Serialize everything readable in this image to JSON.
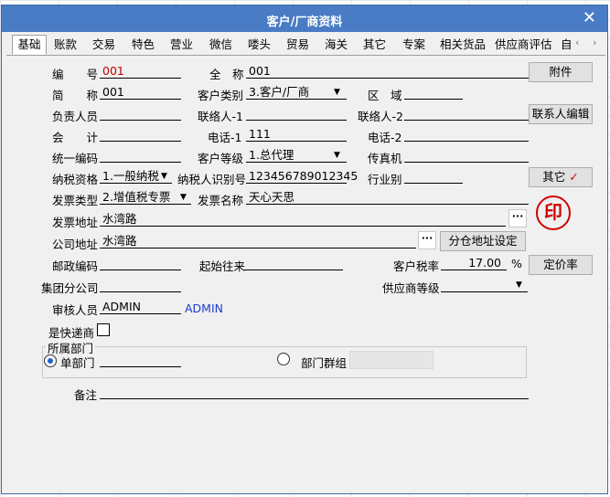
{
  "window": {
    "title": "客户/厂商资料"
  },
  "tabs": [
    "基础",
    "账款",
    "交易",
    "特色",
    "营业",
    "微信",
    "喽头",
    "贸易",
    "海关",
    "其它",
    "专案",
    "相关货品",
    "供应商评估",
    "自"
  ],
  "icons": {
    "close": "close-icon",
    "tab_left": "chevron-left-icon",
    "tab_right": "chevron-right-icon",
    "check": "checkmark-icon",
    "seal": "seal-stamp-icon"
  },
  "colors": {
    "titlebar": "#4a7cc5",
    "code_value": "#c00000",
    "approver_link": "#1a3cc8",
    "checkmark": "#d00000"
  },
  "fields": {
    "code_label": "编　　号",
    "code_value": "001",
    "fullname_label": "全　称",
    "fullname_value": "001",
    "short_label": "简　　称",
    "short_value": "001",
    "cust_type_label": "客户类别",
    "cust_type_value": "3.客户/厂商",
    "region_label": "区　域",
    "region_value": "",
    "person_label": "负责人员",
    "person_value": "",
    "contact1_label": "联络人-1",
    "contact1_value": "",
    "contact2_label": "联络人-2",
    "contact2_value": "",
    "accountant_label": "会　　计",
    "accountant_value": "",
    "phone1_label": "电话-1",
    "phone1_value": "111",
    "phone2_label": "电话-2",
    "phone2_value": "",
    "uscc_label": "统一编码",
    "uscc_value": "",
    "grade_label": "客户等级",
    "grade_value": "1.总代理",
    "fax_label": "传真机",
    "fax_value": "",
    "tax_qual_label": "纳税资格",
    "tax_qual_value": "1.一般纳税",
    "taxid_label": "纳税人识别号",
    "taxid_value": "123456789012345",
    "industry_label": "行业别",
    "industry_value": "",
    "invoice_type_label": "发票类型",
    "invoice_type_value": "2.增值税专票",
    "invoice_name_label": "发票名称",
    "invoice_name_value": "天心天思",
    "invoice_addr_label": "发票地址",
    "invoice_addr_value": "水湾路",
    "company_addr_label": "公司地址",
    "company_addr_value": "水湾路",
    "zip_label": "邮政编码",
    "zip_value": "",
    "origin_label": "起始往来",
    "origin_value": "",
    "tax_rate_label": "客户税率",
    "tax_rate_value": "17.00",
    "tax_rate_unit": "%",
    "group_label": "集团分公司",
    "group_value": "",
    "supplier_grade_label": "供应商等级",
    "supplier_grade_value": "",
    "approver_label": "审核人员",
    "approver_value": "ADMIN",
    "approver_name": "ADMIN",
    "express_label": "是快递商",
    "express_checked": false,
    "dept_group_title": "所属部门",
    "single_dept_label": "单部门",
    "single_dept_value": "",
    "dept_group_label": "部门群组",
    "dept_group_value": "",
    "remark_label": "备注",
    "remark_value": ""
  },
  "buttons": {
    "attachment": "附件",
    "contact_edit": "联系人编辑",
    "other": "其它",
    "branch_addr": "分仓地址设定",
    "pricing": "定价率",
    "ellipsis": "···"
  }
}
